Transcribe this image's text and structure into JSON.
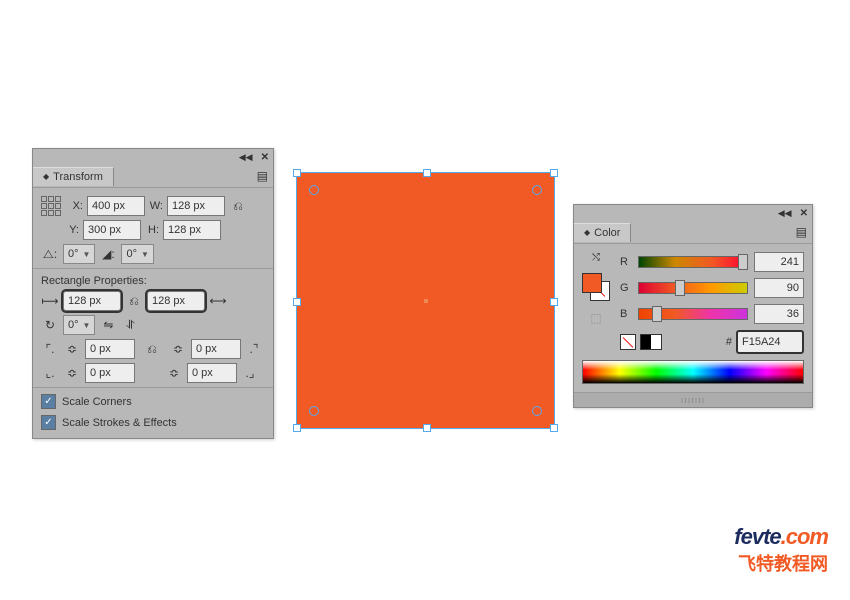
{
  "transform": {
    "tab_label": "Transform",
    "x_label": "X:",
    "x_value": "400 px",
    "y_label": "Y:",
    "y_value": "300 px",
    "w_label": "W:",
    "w_value": "128 px",
    "h_label": "H:",
    "h_value": "128 px",
    "shear_value": "0°",
    "rotate_value": "0°",
    "rect_props_label": "Rectangle Properties:",
    "rect_w": "128 px",
    "rect_h": "128 px",
    "rect_rotate": "0°",
    "corner_tl": "0 px",
    "corner_tr": "0 px",
    "corner_bl": "0 px",
    "corner_br": "0 px",
    "scale_corners_label": "Scale Corners",
    "scale_strokes_label": "Scale Strokes & Effects"
  },
  "color": {
    "tab_label": "Color",
    "r_label": "R",
    "r_value": "241",
    "g_label": "G",
    "g_value": "90",
    "b_label": "B",
    "b_value": "36",
    "hex_prefix": "#",
    "hex_value": "F15A24",
    "fill_color": "#F15A24"
  },
  "watermark": {
    "line1_a": "fevte",
    "line1_b": ".com",
    "line2": "飞特教程网"
  }
}
